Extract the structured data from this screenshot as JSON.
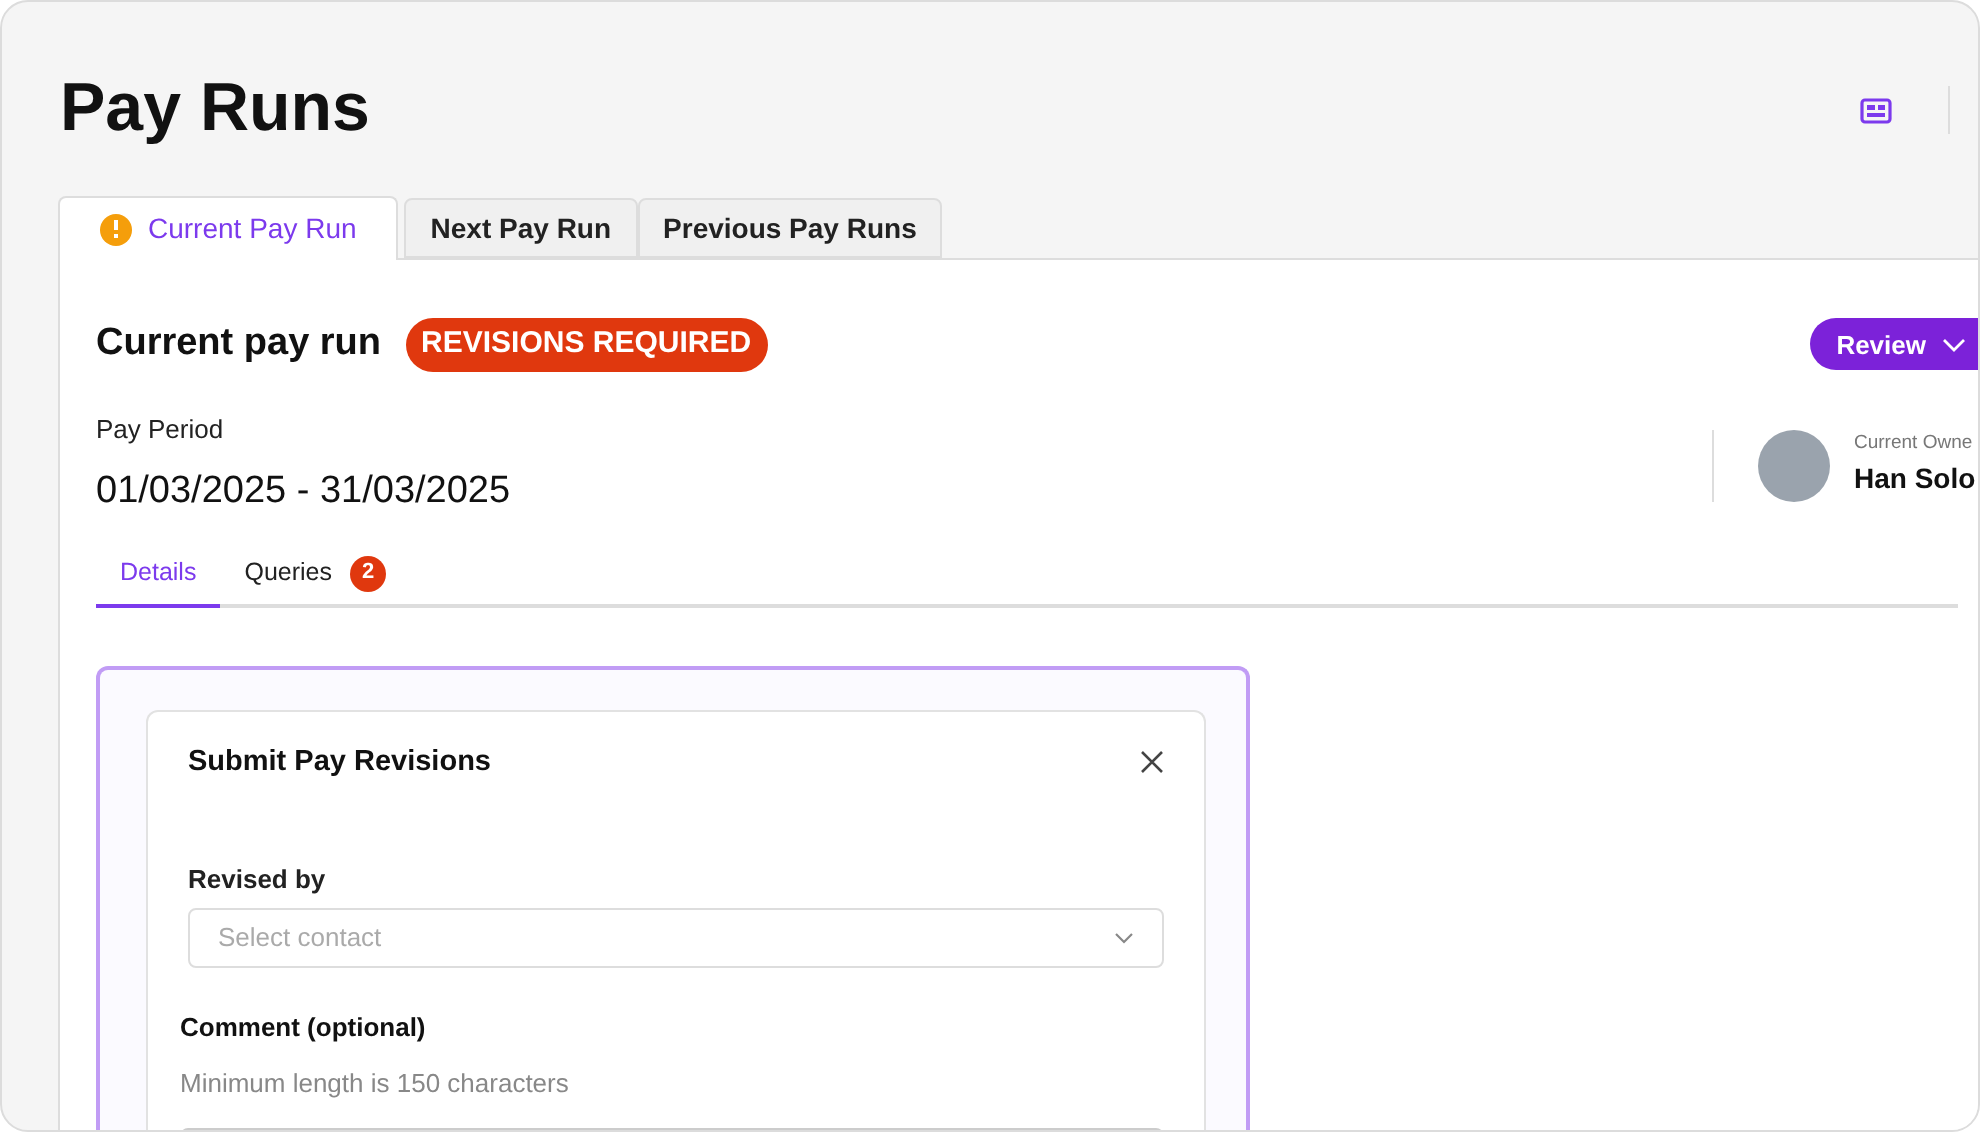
{
  "page": {
    "title": "Pay Runs"
  },
  "tabs": [
    {
      "label": "Current Pay Run",
      "selected": true,
      "warning": true
    },
    {
      "label": "Next Pay Run",
      "selected": false,
      "warning": false
    },
    {
      "label": "Previous Pay Runs",
      "selected": false,
      "warning": false
    }
  ],
  "pay_run": {
    "heading": "Current pay run",
    "status": "REVISIONS REQUIRED",
    "review_button": "Review",
    "period_label": "Pay Period",
    "period": "01/03/2025 - 31/03/2025",
    "owner_label": "Current Owne",
    "owner": "Han Solo"
  },
  "subtabs": [
    {
      "label": "Details",
      "selected": true
    },
    {
      "label": "Queries",
      "selected": false,
      "count": "2"
    }
  ],
  "dialog": {
    "title": "Submit Pay Revisions",
    "revised_by_label": "Revised by",
    "revised_by_placeholder": "Select contact",
    "comment_label": "Comment (optional)",
    "comment_hint": "Minimum length is 150 characters"
  }
}
